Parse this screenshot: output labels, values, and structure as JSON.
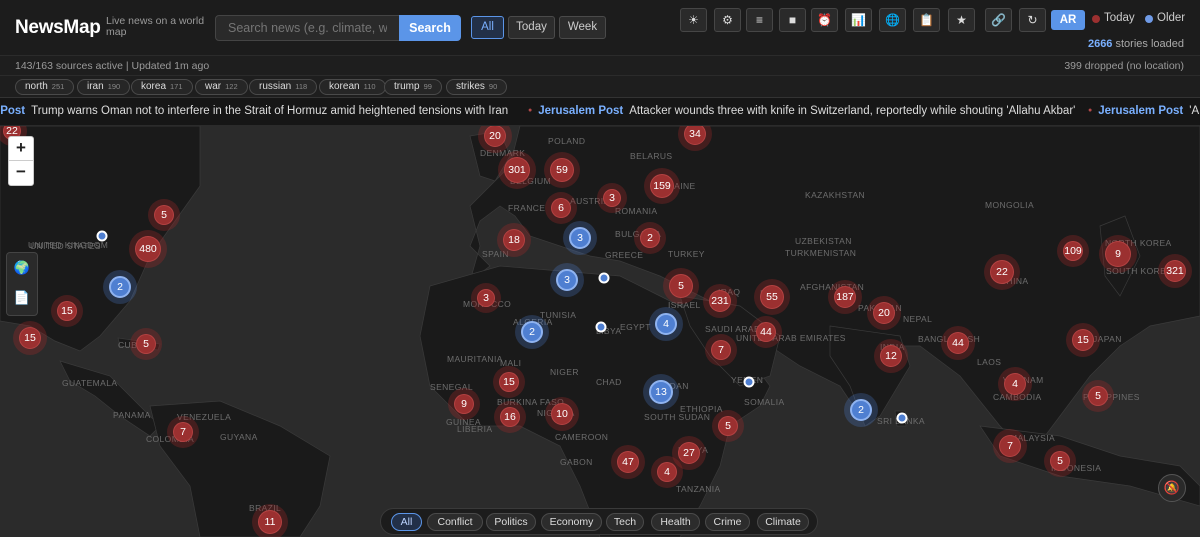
{
  "header": {
    "brand": "NewsMap",
    "tagline": "Live news on a world map",
    "search_placeholder": "Search news (e.g. climate, war, te",
    "search_button": "Search",
    "time_filters": [
      {
        "label": "All",
        "active": true
      },
      {
        "label": "Today",
        "active": false
      },
      {
        "label": "Week",
        "active": false
      }
    ],
    "tools": [
      {
        "name": "theme-toggle-icon",
        "glyph": "☀"
      },
      {
        "name": "settings-icon",
        "glyph": "⚙"
      },
      {
        "name": "list-icon",
        "glyph": "≡"
      },
      {
        "name": "stop-icon",
        "glyph": "■"
      },
      {
        "name": "alarm-icon",
        "glyph": "⏰"
      },
      {
        "name": "chart-icon",
        "glyph": "📊"
      },
      {
        "name": "globe-icon",
        "glyph": "🌐"
      },
      {
        "name": "clipboard-icon",
        "glyph": "📋"
      },
      {
        "name": "star-icon",
        "glyph": "★"
      },
      {
        "name": "link-icon",
        "glyph": "🔗"
      },
      {
        "name": "refresh-icon",
        "glyph": "↻"
      }
    ],
    "lang_button": "AR",
    "legend_today": "Today",
    "legend_older": "Older",
    "stories_count": "2666",
    "stories_suffix": "stories loaded"
  },
  "status": {
    "left": "143/163 sources active | Updated 1m ago",
    "right": "399 dropped (no location)"
  },
  "tags": [
    {
      "label": "north",
      "count": "251"
    },
    {
      "label": "iran",
      "count": "190"
    },
    {
      "label": "korea",
      "count": "171"
    },
    {
      "label": "war",
      "count": "122"
    },
    {
      "label": "russian",
      "count": "118"
    },
    {
      "label": "korean",
      "count": "110"
    },
    {
      "label": "trump",
      "count": "99"
    },
    {
      "label": "strikes",
      "count": "90"
    }
  ],
  "ticker": [
    {
      "source": "n Post",
      "headline": "Trump warns Oman not to interfere in the Strait of Hormuz amid heightened tensions with Iran"
    },
    {
      "source": "Jerusalem Post",
      "headline": "Attacker wounds three with knife in Switzerland, reportedly while shouting 'Allahu Akbar'"
    },
    {
      "source": "Jerusalem Post",
      "headline": "'A nat"
    }
  ],
  "map": {
    "country_labels": [
      "UNITED KINGDOM",
      "DENMARK",
      "POLAND",
      "BELARUS",
      "BELGIUM",
      "UKRAINE",
      "FRANCE",
      "AUSTRIA",
      "ROMANIA",
      "KAZAKHSTAN",
      "MONGOLIA",
      "BULGARIA",
      "UZBEKISTAN",
      "TURKMENISTAN",
      "SPAIN",
      "GREECE",
      "TURKEY",
      "NORTH KOREA",
      "SOUTH KOREA",
      "CHINA",
      "AFGHANISTAN",
      "PAKISTAN",
      "IRAN",
      "IRAQ",
      "ISRAEL",
      "MOROCCO",
      "TUNISIA",
      "ALGERIA",
      "LIBYA",
      "EGYPT",
      "SAUDI ARABIA",
      "UNITED ARAB EMIRATES",
      "NEPAL",
      "INDIA",
      "BANGLADESH",
      "LAOS",
      "JAPAN",
      "MAURITANIA",
      "MALI",
      "NIGER",
      "CHAD",
      "SUDAN",
      "YEMEN",
      "VIETNAM",
      "CAMBODIA",
      "PHILIPPINES",
      "SENEGAL",
      "BURKINA FASO",
      "NIGERIA",
      "ETHIOPIA",
      "SOUTH SUDAN",
      "SOMALIA",
      "SRI LANKA",
      "GUINEA",
      "LIBERIA",
      "CAMEROON",
      "GABON",
      "KENYA",
      "TANZANIA",
      "MALAYSIA",
      "INDONESIA",
      "GUATEMALA",
      "PANAMA",
      "VENEZUELA",
      "GUYANA",
      "COLOMBIA",
      "CUBA",
      "BRAZIL",
      "UNITED STATES"
    ],
    "clusters_red": [
      "22",
      "20",
      "34",
      "301",
      "59",
      "159",
      "5",
      "480",
      "6",
      "3",
      "18",
      "2",
      "3",
      "15",
      "5",
      "5",
      "231",
      "55",
      "187",
      "22",
      "109",
      "9",
      "321",
      "20",
      "44",
      "7",
      "12",
      "44",
      "15",
      "15",
      "4",
      "9",
      "16",
      "10",
      "7",
      "5",
      "27",
      "47",
      "4",
      "7",
      "5",
      "15",
      "5",
      "11"
    ],
    "clusters_blue": [
      "2",
      "3",
      "3",
      "2",
      "4",
      "13",
      "2"
    ]
  },
  "categories": [
    {
      "label": "All",
      "active": true
    },
    {
      "label": "Conflict",
      "active": false
    },
    {
      "label": "Politics",
      "active": false
    },
    {
      "label": "Economy",
      "active": false
    },
    {
      "label": "Tech",
      "active": false
    },
    {
      "label": "Health",
      "active": false
    },
    {
      "label": "Crime",
      "active": false
    },
    {
      "label": "Climate",
      "active": false
    }
  ],
  "colors": {
    "accent": "#5b95e8",
    "today": "#9b3030",
    "older": "#4f7fd1"
  }
}
